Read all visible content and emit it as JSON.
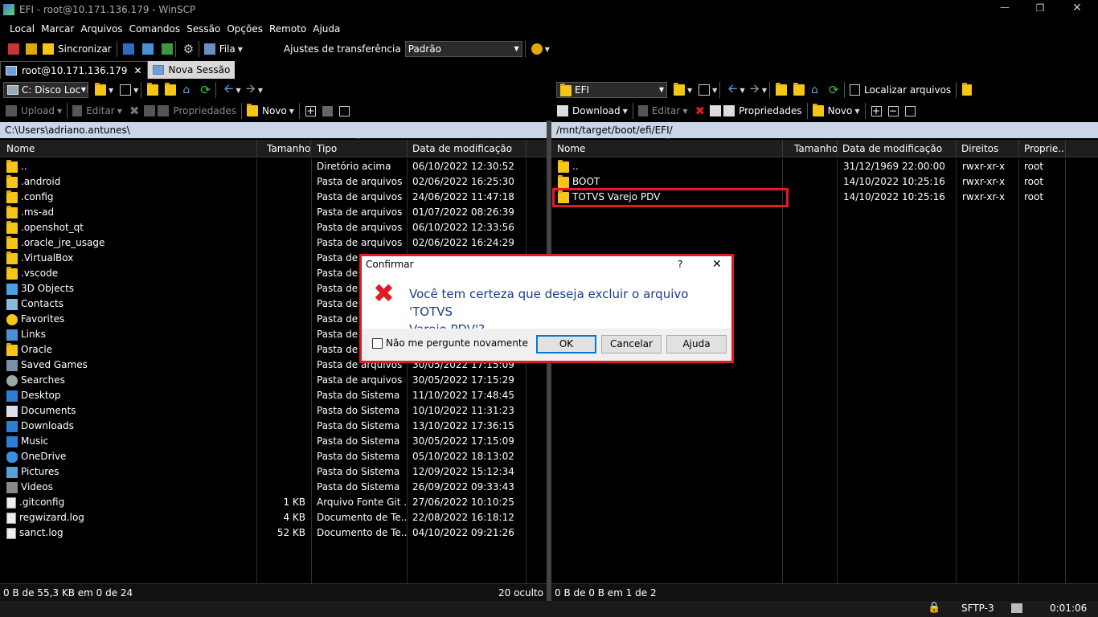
{
  "window": {
    "title": "EFI - root@10.171.136.179 - WinSCP"
  },
  "menu": [
    "Local",
    "Marcar",
    "Arquivos",
    "Comandos",
    "Sessão",
    "Opções",
    "Remoto",
    "Ajuda"
  ],
  "toolbar": {
    "sync_label": "Sincronizar",
    "queue_label": "Fila",
    "transfer_settings_label": "Ajustes de transferência",
    "transfer_settings_value": "Padrão"
  },
  "tabs": [
    {
      "label": "root@10.171.136.179"
    },
    {
      "label": "Nova Sessão"
    }
  ],
  "left": {
    "drive": "C: Disco Local",
    "actions": {
      "upload": "Upload",
      "edit": "Editar",
      "properties": "Propriedades",
      "new": "Novo"
    },
    "path": "C:\\Users\\adriano.antunes\\",
    "columns": [
      "Nome",
      "Tamanho",
      "Tipo",
      "Data de modificação"
    ],
    "rows": [
      {
        "name": "..",
        "size": "",
        "type": "Diretório acima",
        "date": "06/10/2022  12:30:52",
        "icon": "parent-folder"
      },
      {
        "name": ".android",
        "size": "",
        "type": "Pasta de arquivos",
        "date": "02/06/2022  16:25:30",
        "icon": "folder"
      },
      {
        "name": ".config",
        "size": "",
        "type": "Pasta de arquivos",
        "date": "24/06/2022  11:47:18",
        "icon": "folder"
      },
      {
        "name": ".ms-ad",
        "size": "",
        "type": "Pasta de arquivos",
        "date": "01/07/2022  08:26:39",
        "icon": "folder"
      },
      {
        "name": ".openshot_qt",
        "size": "",
        "type": "Pasta de arquivos",
        "date": "06/10/2022  12:33:56",
        "icon": "folder"
      },
      {
        "name": ".oracle_jre_usage",
        "size": "",
        "type": "Pasta de arquivos",
        "date": "02/06/2022  16:24:29",
        "icon": "folder"
      },
      {
        "name": ".VirtualBox",
        "size": "",
        "type": "Pasta de a",
        "date": "",
        "icon": "folder"
      },
      {
        "name": ".vscode",
        "size": "",
        "type": "Pasta de a",
        "date": "",
        "icon": "folder"
      },
      {
        "name": "3D Objects",
        "size": "",
        "type": "Pasta de a",
        "date": "",
        "icon": "3d-objects"
      },
      {
        "name": "Contacts",
        "size": "",
        "type": "Pasta de a",
        "date": "",
        "icon": "contacts"
      },
      {
        "name": "Favorites",
        "size": "",
        "type": "Pasta de a",
        "date": "",
        "icon": "star"
      },
      {
        "name": "Links",
        "size": "",
        "type": "Pasta de a",
        "date": "",
        "icon": "links"
      },
      {
        "name": "Oracle",
        "size": "",
        "type": "Pasta de a",
        "date": "",
        "icon": "folder"
      },
      {
        "name": "Saved Games",
        "size": "",
        "type": "Pasta de arquivos",
        "date": "30/05/2022  17:15:09",
        "icon": "saved-games"
      },
      {
        "name": "Searches",
        "size": "",
        "type": "Pasta de arquivos",
        "date": "30/05/2022  17:15:29",
        "icon": "search"
      },
      {
        "name": "Desktop",
        "size": "",
        "type": "Pasta do Sistema",
        "date": "11/10/2022  17:48:45",
        "icon": "desktop"
      },
      {
        "name": "Documents",
        "size": "",
        "type": "Pasta do Sistema",
        "date": "10/10/2022  11:31:23",
        "icon": "documents"
      },
      {
        "name": "Downloads",
        "size": "",
        "type": "Pasta do Sistema",
        "date": "13/10/2022  17:36:15",
        "icon": "download"
      },
      {
        "name": "Music",
        "size": "",
        "type": "Pasta do Sistema",
        "date": "30/05/2022  17:15:09",
        "icon": "music"
      },
      {
        "name": "OneDrive",
        "size": "",
        "type": "Pasta do Sistema",
        "date": "05/10/2022  18:13:02",
        "icon": "cloud"
      },
      {
        "name": "Pictures",
        "size": "",
        "type": "Pasta do Sistema",
        "date": "12/09/2022  15:12:34",
        "icon": "pictures"
      },
      {
        "name": "Videos",
        "size": "",
        "type": "Pasta do Sistema",
        "date": "26/09/2022  09:33:43",
        "icon": "videos"
      },
      {
        "name": ".gitconfig",
        "size": "1 KB",
        "type": "Arquivo Fonte Git ...",
        "date": "27/06/2022  10:10:25",
        "icon": "file"
      },
      {
        "name": "regwizard.log",
        "size": "4 KB",
        "type": "Documento de Te...",
        "date": "22/08/2022  16:18:12",
        "icon": "file"
      },
      {
        "name": "sanct.log",
        "size": "52 KB",
        "type": "Documento de Te...",
        "date": "04/10/2022  09:21:26",
        "icon": "file"
      }
    ],
    "status": "0 B de 55,3 KB em 0 de 24",
    "hidden": "20 oculto"
  },
  "right": {
    "dir": "EFI",
    "find_label": "Localizar arquivos",
    "actions": {
      "download": "Download",
      "edit": "Editar",
      "properties": "Propriedades",
      "new": "Novo"
    },
    "path": "/mnt/target/boot/efi/EFI/",
    "columns": [
      "Nome",
      "Tamanho",
      "Data de modificação",
      "Direitos",
      "Proprie..."
    ],
    "rows": [
      {
        "name": "..",
        "size": "",
        "date": "31/12/1969 22:00:00",
        "rights": "rwxr-xr-x",
        "owner": "root"
      },
      {
        "name": "BOOT",
        "size": "",
        "date": "14/10/2022 10:25:16",
        "rights": "rwxr-xr-x",
        "owner": "root"
      },
      {
        "name": "TOTVS Varejo PDV",
        "size": "",
        "date": "14/10/2022 10:25:16",
        "rights": "rwxr-xr-x",
        "owner": "root"
      }
    ],
    "status": "0 B de 0 B em 1 de 2"
  },
  "statusbar": {
    "protocol": "SFTP-3",
    "time": "0:01:06"
  },
  "dialog": {
    "title": "Confirmar",
    "help_glyph": "?",
    "message_line1": "Você tem certeza que deseja excluir o arquivo 'TOTVS",
    "message_line2": "Varejo PDV'?",
    "checkbox_label": "Não me pergunte novamente",
    "ok": "OK",
    "cancel": "Cancelar",
    "help": "Ajuda"
  },
  "colors": {
    "highlight": "#e01b24",
    "path_bg": "#c9d6e8",
    "message": "#1a3c8f"
  }
}
